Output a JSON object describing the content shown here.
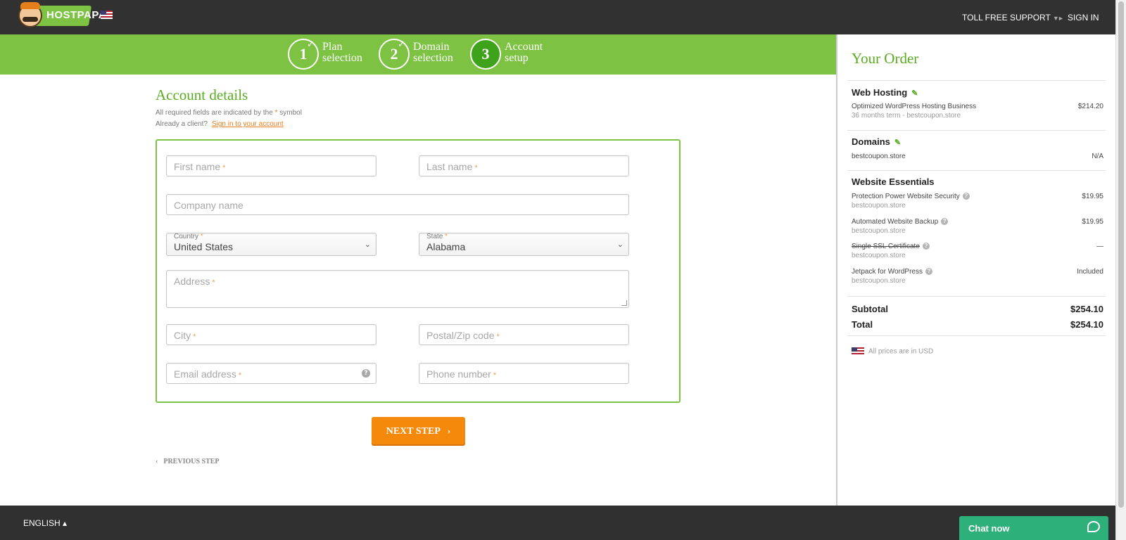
{
  "header": {
    "logo_text": "HOSTPAPA",
    "toll_free": "TOLL FREE SUPPORT",
    "sign_in": "SIGN IN"
  },
  "steps": [
    {
      "number": "1",
      "line1": "Plan",
      "line2": "selection",
      "completed": true
    },
    {
      "number": "2",
      "line1": "Domain",
      "line2": "selection",
      "completed": true
    },
    {
      "number": "3",
      "line1": "Account",
      "line2": "setup",
      "active": true
    }
  ],
  "account": {
    "title": "Account details",
    "required_note_prefix": "All required fields are indicated by the",
    "required_star": "*",
    "required_note_suffix": "symbol",
    "already_client": "Already a client?",
    "sign_in_link": "Sign in to your account"
  },
  "form": {
    "first_name": "First name",
    "last_name": "Last name",
    "company": "Company name",
    "country_label": "Country",
    "country_value": "United States",
    "state_label": "State",
    "state_value": "Alabama",
    "address": "Address",
    "city": "City",
    "postal": "Postal/Zip code",
    "email": "Email address",
    "phone": "Phone number",
    "star": "*"
  },
  "buttons": {
    "next": "NEXT STEP",
    "previous": "PREVIOUS STEP"
  },
  "order": {
    "title": "Your Order",
    "web_hosting": {
      "title": "Web Hosting",
      "item": "Optimized WordPress Hosting Business",
      "sub": "36 months term - bestcoupon.store",
      "price": "$214.20"
    },
    "domains": {
      "title": "Domains",
      "item": "bestcoupon.store",
      "price": "N/A"
    },
    "essentials": {
      "title": "Website Essentials",
      "items": [
        {
          "name": "Protection Power Website Security",
          "sub": "bestcoupon.store",
          "price": "$19.95"
        },
        {
          "name": "Automated Website Backup",
          "sub": "bestcoupon.store",
          "price": "$19.95"
        },
        {
          "name": "Single SSL Certificate",
          "sub": "bestcoupon.store",
          "price": "—"
        },
        {
          "name": "Jetpack for WordPress",
          "sub": "bestcoupon.store",
          "price": "Included"
        }
      ]
    },
    "subtotal_label": "Subtotal",
    "subtotal": "$254.10",
    "total_label": "Total",
    "total": "$254.10",
    "usd_note": "All prices are in USD"
  },
  "footer": {
    "language": "ENGLISH",
    "chat": "Chat now"
  },
  "colors": {
    "accent_green": "#7dc242",
    "title_green": "#5aab22",
    "orange": "#f5890c",
    "dark_bar": "#313131",
    "chat_green": "#2eb07a"
  }
}
